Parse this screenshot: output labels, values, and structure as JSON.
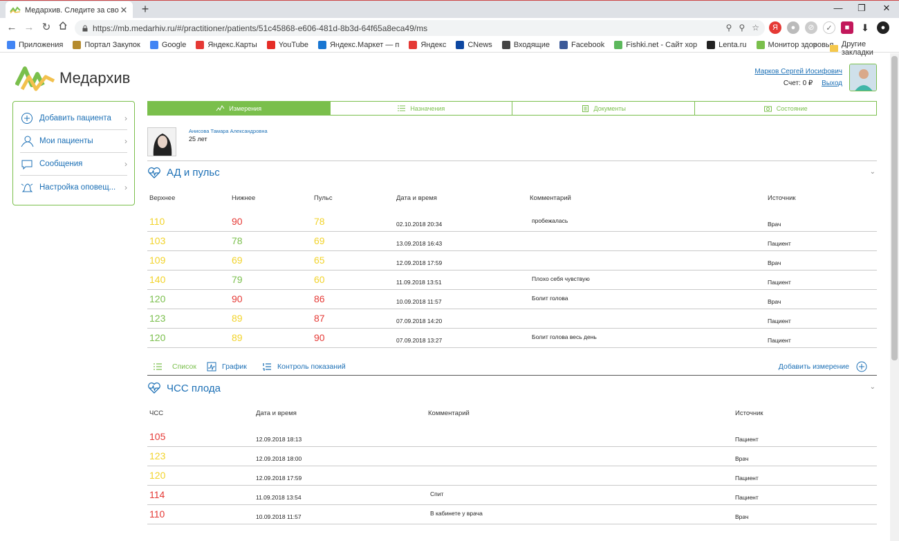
{
  "browser": {
    "tab_title": "Медархив. Следите за своим зд",
    "url": "https://mb.medarhiv.ru/#/practitioner/patients/51c45868-e606-481d-8b3d-64f65a8eca49/ms",
    "bookmarks": [
      {
        "label": "Приложения",
        "icon": "apps-icon",
        "color": "#4285f4"
      },
      {
        "label": "Портал Закупок",
        "icon": "emblem-icon",
        "color": "#b58b2e"
      },
      {
        "label": "Google",
        "icon": "google-icon",
        "color": "#4285f4"
      },
      {
        "label": "Яндекс.Карты",
        "icon": "map-pin-icon",
        "color": "#e53935"
      },
      {
        "label": "YouTube",
        "icon": "youtube-icon",
        "color": "#e52d27"
      },
      {
        "label": "Яндекс.Маркет — п",
        "icon": "cart-icon",
        "color": "#1976d2"
      },
      {
        "label": "Яндекс",
        "icon": "yandex-icon",
        "color": "#e53935"
      },
      {
        "label": "CNews",
        "icon": "cnews-icon",
        "color": "#0d47a1"
      },
      {
        "label": "Входящие",
        "icon": "mail-icon",
        "color": "#444444"
      },
      {
        "label": "Facebook",
        "icon": "facebook-icon",
        "color": "#3b5998"
      },
      {
        "label": "Fishki.net - Сайт хор",
        "icon": "fishki-icon",
        "color": "#5cb85c"
      },
      {
        "label": "Lenta.ru",
        "icon": "lenta-icon",
        "color": "#222222"
      },
      {
        "label": "Монитор здоровья",
        "icon": "pulse-icon",
        "color": "#7abf4c"
      }
    ],
    "other_bookmarks": "Другие закладки"
  },
  "header": {
    "logo_text": "Медархив",
    "user_name": "Марков Сергей Иосифович",
    "balance": "Счет: 0 ₽",
    "logout": "Выход"
  },
  "sidebar": {
    "items": [
      {
        "label": "Добавить пациента",
        "icon": "add-circle-icon"
      },
      {
        "label": "Мои пациенты",
        "icon": "person-icon"
      },
      {
        "label": "Сообщения",
        "icon": "chat-icon"
      },
      {
        "label": "Настройка оповещ...",
        "icon": "bell-icon"
      }
    ]
  },
  "tabs": [
    {
      "label": "Измерения",
      "icon": "measure-icon",
      "active": true
    },
    {
      "label": "Назначения",
      "icon": "list-icon",
      "active": false
    },
    {
      "label": "Документы",
      "icon": "clipboard-icon",
      "active": false
    },
    {
      "label": "Состояние",
      "icon": "camera-icon",
      "active": false
    }
  ],
  "patient": {
    "name": "Анисова Тамара Александровна",
    "age": "25 лет"
  },
  "colors": {
    "green": "#7abf4c",
    "yellow": "#f2d32a",
    "red": "#e53935",
    "link": "#1b6fb5"
  },
  "bp_section": {
    "title": "АД и пульс",
    "headers": [
      "Верхнее",
      "Нижнее",
      "Пульс",
      "Дата и время",
      "Комментарий",
      "Источник"
    ],
    "rows": [
      {
        "sys": "110",
        "sys_c": "yellow",
        "dia": "90",
        "dia_c": "red",
        "pulse": "78",
        "pulse_c": "yellow",
        "date": "02.10.2018 20:34",
        "comment": "пробежалась",
        "source": "Врач"
      },
      {
        "sys": "103",
        "sys_c": "yellow",
        "dia": "78",
        "dia_c": "green",
        "pulse": "69",
        "pulse_c": "yellow",
        "date": "13.09.2018 16:43",
        "comment": "",
        "source": "Пациент"
      },
      {
        "sys": "109",
        "sys_c": "yellow",
        "dia": "69",
        "dia_c": "yellow",
        "pulse": "65",
        "pulse_c": "yellow",
        "date": "12.09.2018 17:59",
        "comment": "",
        "source": "Врач"
      },
      {
        "sys": "140",
        "sys_c": "yellow",
        "dia": "79",
        "dia_c": "green",
        "pulse": "60",
        "pulse_c": "yellow",
        "date": "11.09.2018 13:51",
        "comment": "Плохо себя чувствую",
        "source": "Пациент"
      },
      {
        "sys": "120",
        "sys_c": "green",
        "dia": "90",
        "dia_c": "red",
        "pulse": "86",
        "pulse_c": "red",
        "date": "10.09.2018 11:57",
        "comment": "Болит голова",
        "source": "Врач"
      },
      {
        "sys": "123",
        "sys_c": "green",
        "dia": "89",
        "dia_c": "yellow",
        "pulse": "87",
        "pulse_c": "red",
        "date": "07.09.2018 14:20",
        "comment": "",
        "source": "Пациент"
      },
      {
        "sys": "120",
        "sys_c": "green",
        "dia": "89",
        "dia_c": "yellow",
        "pulse": "90",
        "pulse_c": "red",
        "date": "07.09.2018 13:27",
        "comment": "Болит голова весь день",
        "source": "Пациент"
      }
    ],
    "subnav": {
      "list": "Список",
      "graph": "График",
      "control": "Контроль показаний",
      "add": "Добавить измерение"
    }
  },
  "fhr_section": {
    "title": "ЧСС плода",
    "headers": [
      "ЧСС",
      "Дата и время",
      "Комментарий",
      "Источник"
    ],
    "rows": [
      {
        "hr": "105",
        "hr_c": "red",
        "date": "12.09.2018 18:13",
        "comment": "",
        "source": "Пациент"
      },
      {
        "hr": "123",
        "hr_c": "yellow",
        "date": "12.09.2018 18:00",
        "comment": "",
        "source": "Врач"
      },
      {
        "hr": "120",
        "hr_c": "yellow",
        "date": "12.09.2018 17:59",
        "comment": "",
        "source": "Пациент"
      },
      {
        "hr": "114",
        "hr_c": "red",
        "date": "11.09.2018 13:54",
        "comment": "Спит",
        "source": "Пациент"
      },
      {
        "hr": "110",
        "hr_c": "red",
        "date": "10.09.2018 11:57",
        "comment": "В кабинете у врача",
        "source": "Врач"
      }
    ]
  }
}
